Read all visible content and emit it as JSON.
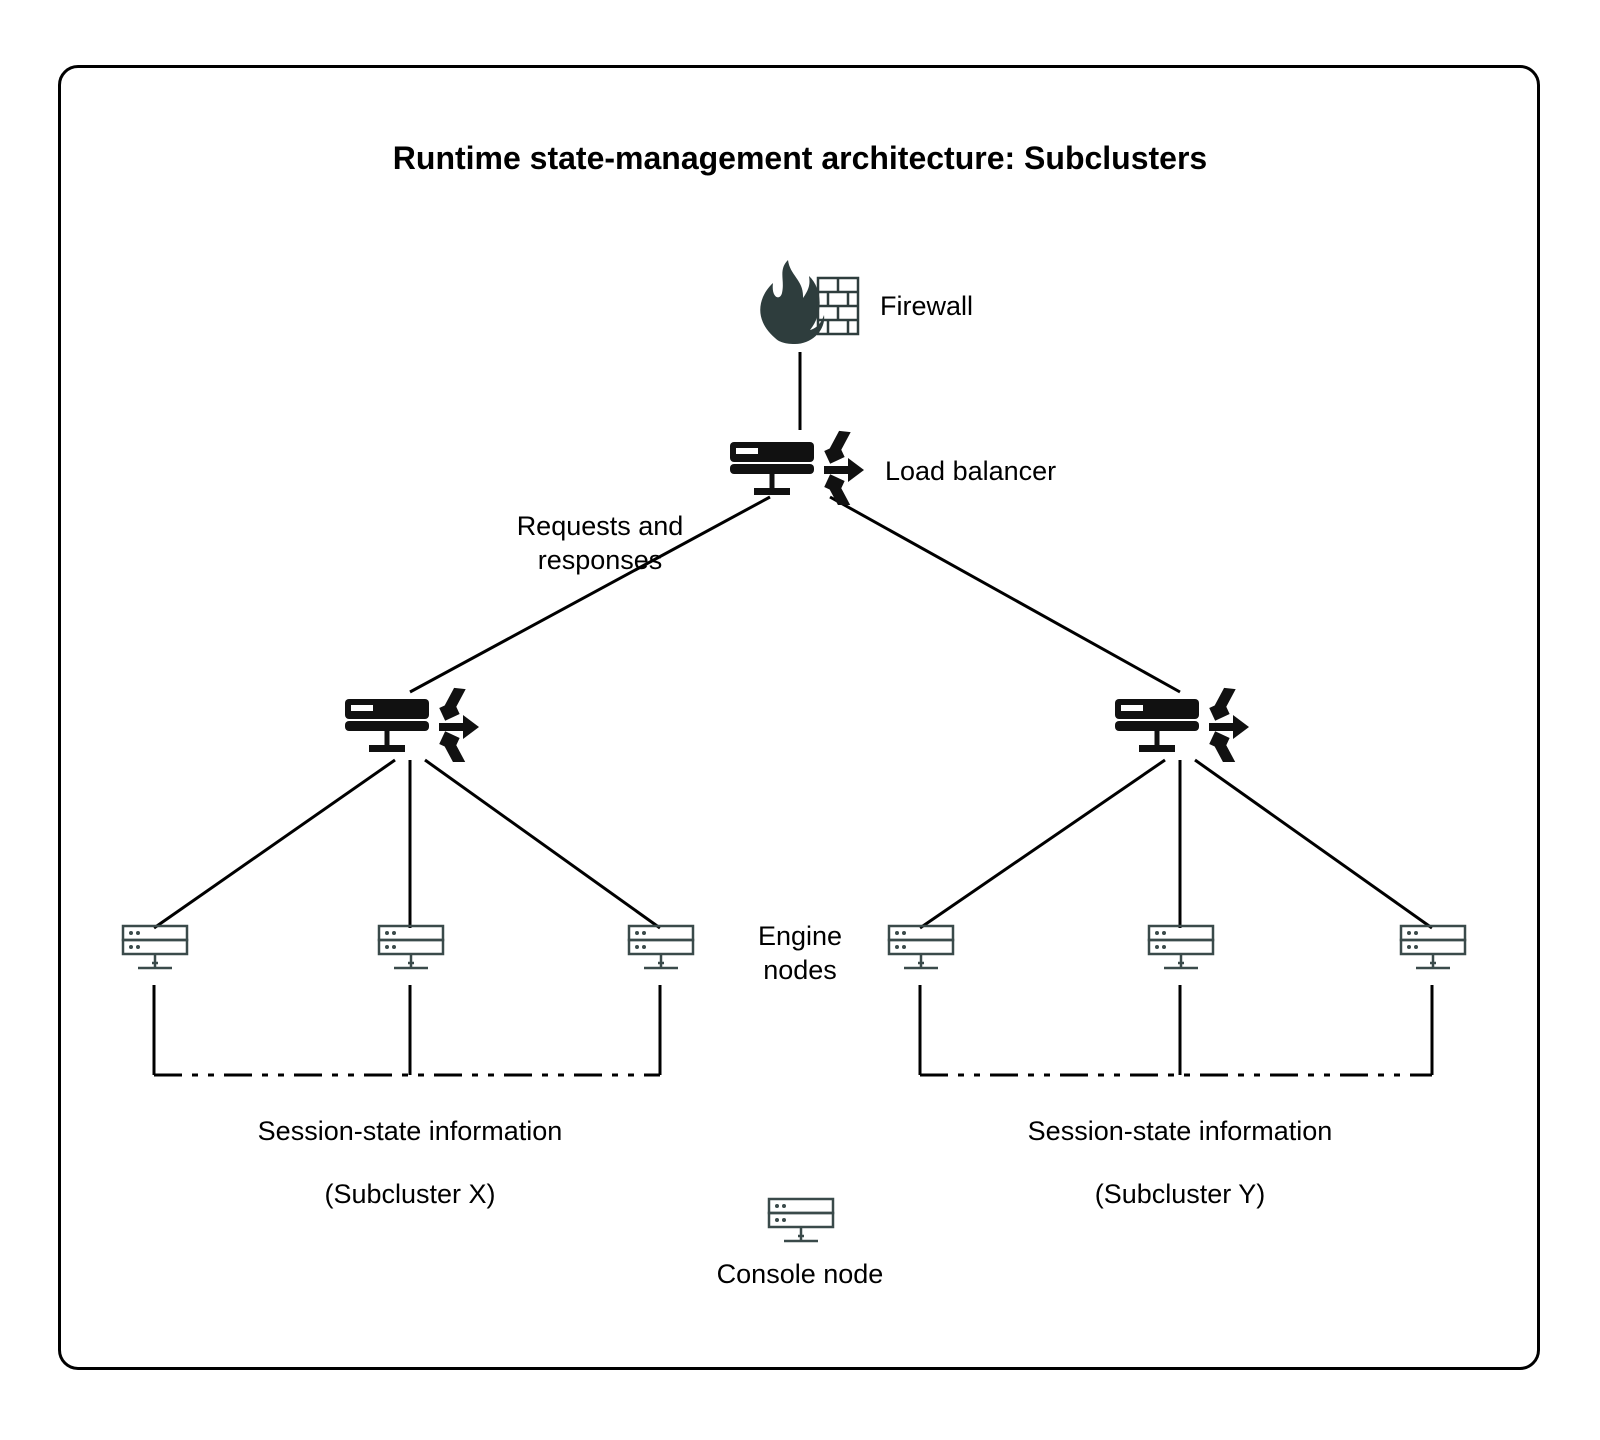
{
  "title": "Runtime state-management architecture: Subclusters",
  "labels": {
    "firewall": "Firewall",
    "load_balancer": "Load balancer",
    "requests": "Requests and",
    "responses": "responses",
    "engine": "Engine",
    "nodes": "nodes",
    "session_state_x": "Session-state information",
    "subcluster_x": "(Subcluster X)",
    "session_state_y": "Session-state information",
    "subcluster_y": "(Subcluster Y)",
    "console_node": "Console node"
  }
}
